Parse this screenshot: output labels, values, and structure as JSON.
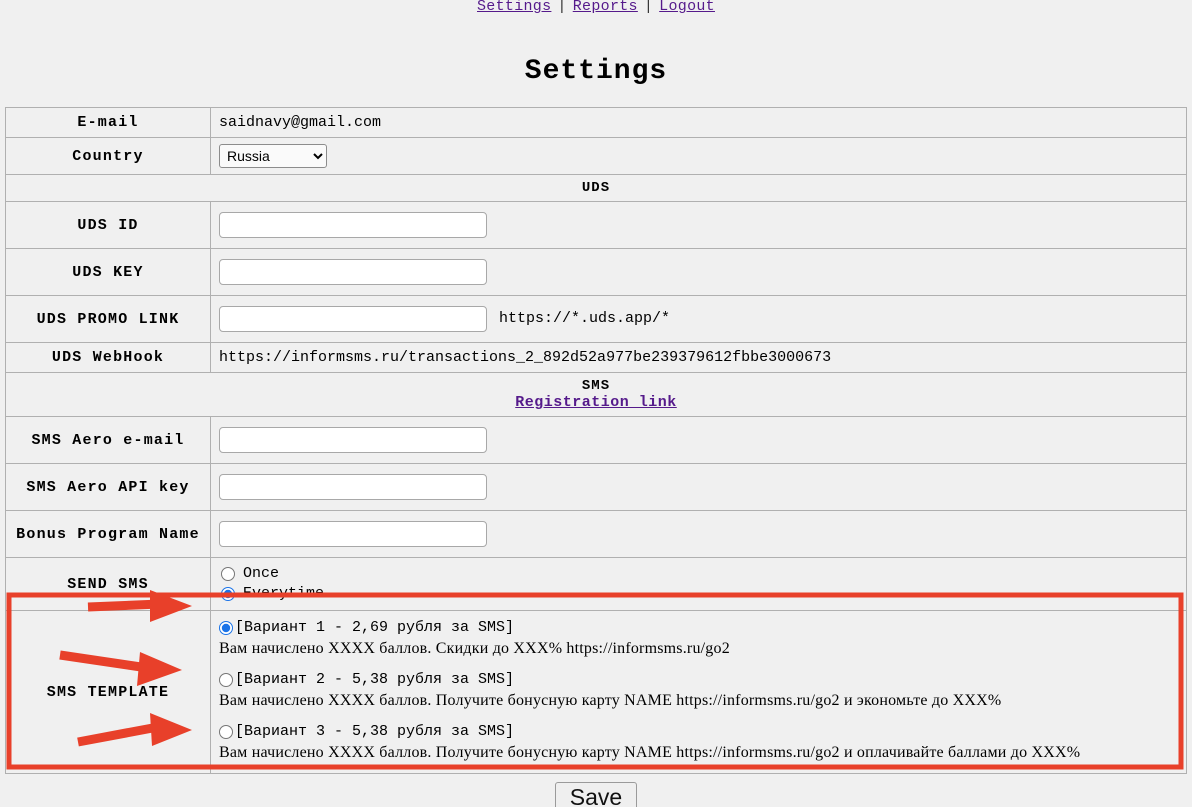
{
  "nav": {
    "items": [
      {
        "label": "Settings",
        "name": "nav-link-settings"
      },
      {
        "label": "Reports",
        "name": "nav-link-reports"
      },
      {
        "label": "Logout",
        "name": "nav-link-logout"
      }
    ],
    "separator": "|"
  },
  "page": {
    "title": "Settings"
  },
  "form": {
    "email": {
      "label": "E-mail",
      "value": "saidnavy@gmail.com"
    },
    "country": {
      "label": "Country",
      "value": "Russia",
      "options": [
        "Russia"
      ]
    },
    "uds_section": {
      "title": "UDS"
    },
    "uds_id": {
      "label": "UDS ID",
      "value": "",
      "placeholder": ""
    },
    "uds_key": {
      "label": "UDS KEY",
      "value": "",
      "placeholder": ""
    },
    "uds_promo_link": {
      "label": "UDS PROMO LINK",
      "value": "",
      "placeholder": "",
      "hint": "https://*.uds.app/*"
    },
    "uds_webhook": {
      "label": "UDS WebHook",
      "value": "https://informsms.ru/transactions_2_892d52a977be239379612fbbe3000673"
    },
    "sms_section": {
      "title": "SMS",
      "registration_link": "Registration link"
    },
    "sms_aero_email": {
      "label": "SMS Aero e-mail",
      "value": "",
      "placeholder": ""
    },
    "sms_aero_api_key": {
      "label": "SMS Aero API key",
      "value": "",
      "placeholder": ""
    },
    "bonus_program_name": {
      "label": "Bonus Program Name",
      "value": "",
      "placeholder": ""
    },
    "send_sms": {
      "label": "SEND SMS",
      "options": [
        {
          "label": "Once",
          "selected": false
        },
        {
          "label": "Everytime",
          "selected": true
        }
      ]
    },
    "sms_template": {
      "label": "SMS TEMPLATE",
      "options": [
        {
          "header": "[Вариант 1 - 2,69 рубля за SMS]",
          "body": "Вам начислено XXXX баллов. Скидки до XXX% https://informsms.ru/go2",
          "selected": true
        },
        {
          "header": "[Вариант 2 - 5,38 рубля за SMS]",
          "body": "Вам начислено XXXX баллов. Получите бонусную карту NAME https://informsms.ru/go2 и экономьте до XXX%",
          "selected": false
        },
        {
          "header": "[Вариант 3 - 5,38 рубля за SMS]",
          "body": "Вам начислено XXXX баллов. Получите бонусную карту NAME https://informsms.ru/go2 и оплачивайте баллами до XXX%",
          "selected": false
        }
      ]
    },
    "save": {
      "label": "Save"
    }
  },
  "annotations": {
    "highlight_color": "#e8402a",
    "arrow_color": "#e8402a",
    "arrow_count": 3,
    "highlight_target": "SMS TEMPLATE"
  }
}
